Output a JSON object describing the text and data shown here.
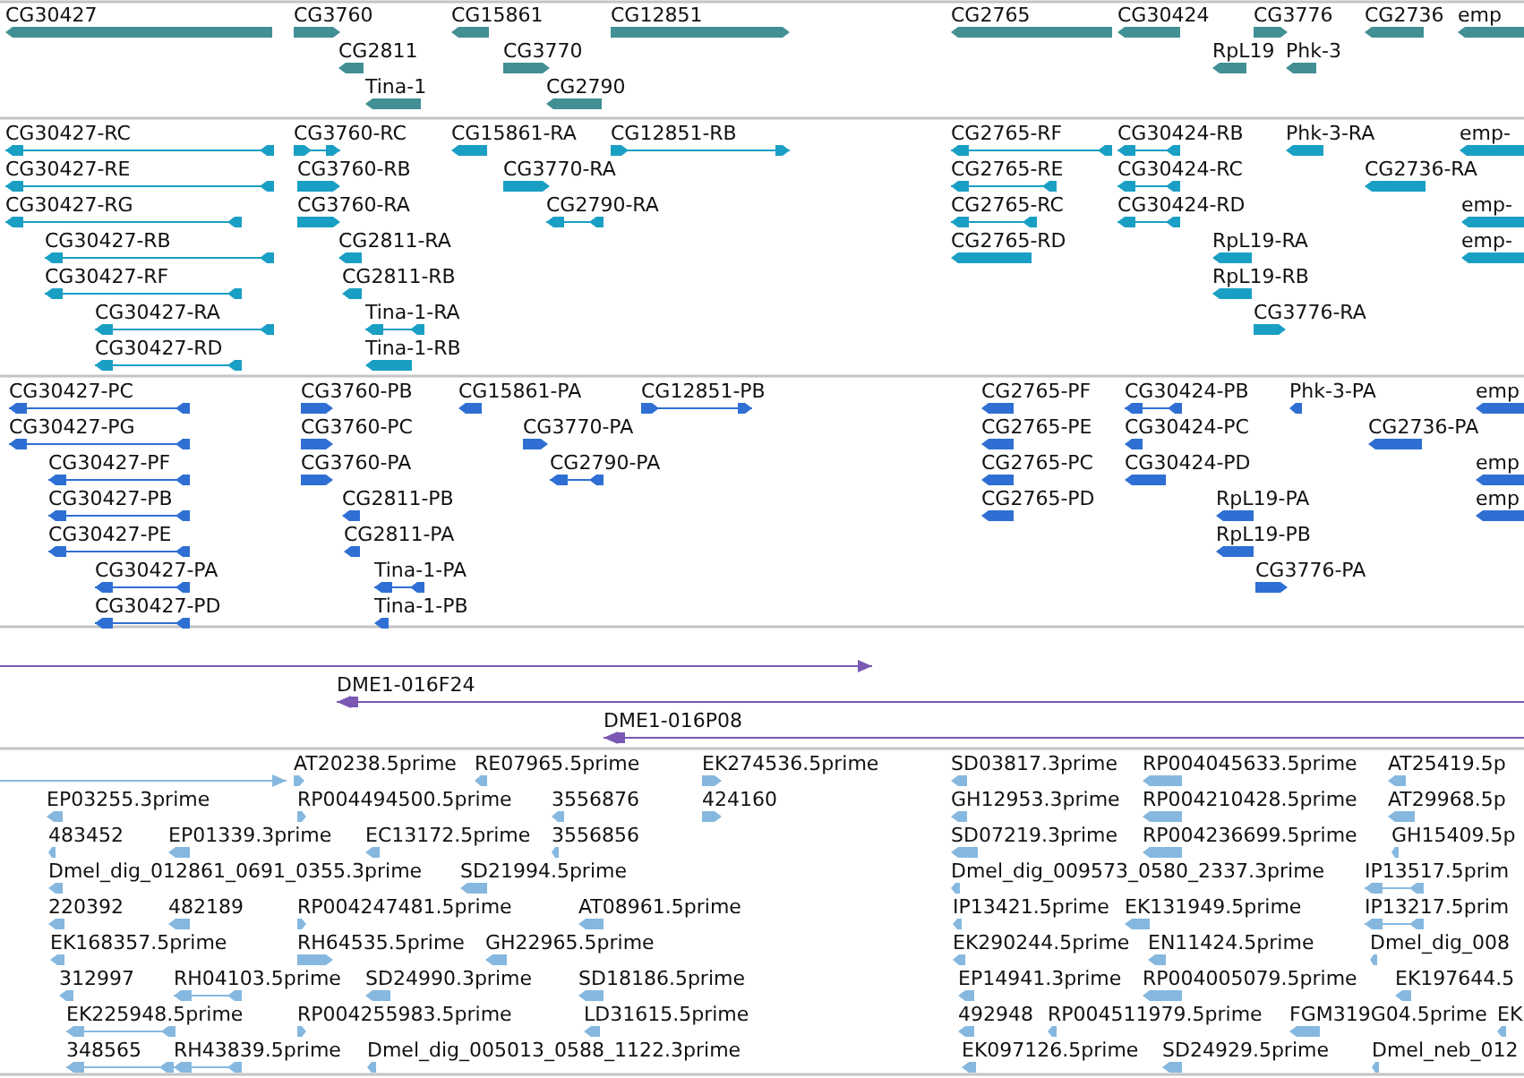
{
  "tracks": [
    {
      "kind": "gene",
      "features": [
        {
          "label": "CG30427",
          "kind": "reverse"
        },
        {
          "label": "CG3760",
          "kind": "forward"
        },
        {
          "label": "CG15861",
          "kind": "reverse"
        },
        {
          "label": "CG12851",
          "kind": "forward"
        },
        {
          "label": "CG2811",
          "kind": "reverse"
        },
        {
          "label": "CG3770",
          "kind": "forward"
        },
        {
          "label": "Tina-1",
          "kind": "reverse"
        },
        {
          "label": "CG2790",
          "kind": "reverse"
        },
        {
          "label": "CG2765",
          "kind": "reverse"
        },
        {
          "label": "CG30424",
          "kind": "reverse"
        },
        {
          "label": "CG3776",
          "kind": "forward"
        },
        {
          "label": "CG2736",
          "kind": "reverse"
        },
        {
          "label": "emp",
          "kind": "reverse"
        },
        {
          "label": "RpL19",
          "kind": "reverse"
        },
        {
          "label": "Phk-3",
          "kind": "reverse"
        }
      ]
    },
    {
      "kind": "transcript",
      "features": [
        {
          "label": "CG30427-RC",
          "kind": "reverse"
        },
        {
          "label": "CG30427-RE",
          "kind": "reverse"
        },
        {
          "label": "CG30427-RG",
          "kind": "reverse"
        },
        {
          "label": "CG30427-RB",
          "kind": "reverse"
        },
        {
          "label": "CG30427-RF",
          "kind": "reverse"
        },
        {
          "label": "CG30427-RA",
          "kind": "reverse"
        },
        {
          "label": "CG30427-RD",
          "kind": "reverse"
        },
        {
          "label": "CG3760-RC",
          "kind": "forward"
        },
        {
          "label": "CG3760-RB",
          "kind": "forward"
        },
        {
          "label": "CG3760-RA",
          "kind": "forward"
        },
        {
          "label": "CG2811-RA",
          "kind": "reverse"
        },
        {
          "label": "CG2811-RB",
          "kind": "reverse"
        },
        {
          "label": "Tina-1-RA",
          "kind": "reverse"
        },
        {
          "label": "Tina-1-RB",
          "kind": "reverse"
        },
        {
          "label": "CG15861-RA",
          "kind": "reverse"
        },
        {
          "label": "CG12851-RB",
          "kind": "forward"
        },
        {
          "label": "CG3770-RA",
          "kind": "forward"
        },
        {
          "label": "CG2790-RA",
          "kind": "reverse"
        },
        {
          "label": "CG2765-RF",
          "kind": "reverse"
        },
        {
          "label": "CG2765-RE",
          "kind": "reverse"
        },
        {
          "label": "CG2765-RC",
          "kind": "reverse"
        },
        {
          "label": "CG2765-RD",
          "kind": "reverse"
        },
        {
          "label": "CG30424-RB",
          "kind": "reverse"
        },
        {
          "label": "CG30424-RC",
          "kind": "reverse"
        },
        {
          "label": "CG30424-RD",
          "kind": "reverse"
        },
        {
          "label": "Phk-3-RA",
          "kind": "reverse"
        },
        {
          "label": "CG2736-RA",
          "kind": "reverse"
        },
        {
          "label": "RpL19-RA",
          "kind": "reverse"
        },
        {
          "label": "RpL19-RB",
          "kind": "reverse"
        },
        {
          "label": "CG3776-RA",
          "kind": "forward"
        },
        {
          "label": "emp-",
          "kind": "reverse"
        },
        {
          "label": "emp-",
          "kind": "reverse"
        },
        {
          "label": "emp-",
          "kind": "reverse"
        }
      ]
    },
    {
      "kind": "protein",
      "features": [
        {
          "label": "CG30427-PC",
          "kind": "reverse"
        },
        {
          "label": "CG30427-PG",
          "kind": "reverse"
        },
        {
          "label": "CG30427-PF",
          "kind": "reverse"
        },
        {
          "label": "CG30427-PB",
          "kind": "reverse"
        },
        {
          "label": "CG30427-PE",
          "kind": "reverse"
        },
        {
          "label": "CG30427-PA",
          "kind": "reverse"
        },
        {
          "label": "CG30427-PD",
          "kind": "reverse"
        },
        {
          "label": "CG3760-PB",
          "kind": "forward"
        },
        {
          "label": "CG3760-PC",
          "kind": "forward"
        },
        {
          "label": "CG3760-PA",
          "kind": "forward"
        },
        {
          "label": "CG2811-PB",
          "kind": "reverse"
        },
        {
          "label": "CG2811-PA",
          "kind": "reverse"
        },
        {
          "label": "Tina-1-PA",
          "kind": "reverse"
        },
        {
          "label": "Tina-1-PB",
          "kind": "reverse"
        },
        {
          "label": "CG15861-PA",
          "kind": "reverse"
        },
        {
          "label": "CG12851-PB",
          "kind": "forward"
        },
        {
          "label": "CG3770-PA",
          "kind": "forward"
        },
        {
          "label": "CG2790-PA",
          "kind": "reverse"
        },
        {
          "label": "CG2765-PF",
          "kind": "reverse"
        },
        {
          "label": "CG2765-PE",
          "kind": "reverse"
        },
        {
          "label": "CG2765-PC",
          "kind": "reverse"
        },
        {
          "label": "CG2765-PD",
          "kind": "reverse"
        },
        {
          "label": "CG30424-PB",
          "kind": "reverse"
        },
        {
          "label": "CG30424-PC",
          "kind": "reverse"
        },
        {
          "label": "CG30424-PD",
          "kind": "reverse"
        },
        {
          "label": "Phk-3-PA",
          "kind": "reverse"
        },
        {
          "label": "CG2736-PA",
          "kind": "reverse"
        },
        {
          "label": "RpL19-PA",
          "kind": "reverse"
        },
        {
          "label": "RpL19-PB",
          "kind": "reverse"
        },
        {
          "label": "CG3776-PA",
          "kind": "forward"
        },
        {
          "label": "emp",
          "kind": "reverse"
        },
        {
          "label": "emp",
          "kind": "reverse"
        },
        {
          "label": "emp",
          "kind": "reverse"
        }
      ]
    },
    {
      "kind": "clone",
      "features": [
        {
          "kind": "forward"
        },
        {
          "label": "DME1-016F24",
          "kind": "reverse"
        },
        {
          "label": "DME1-016P08",
          "kind": "reverse"
        }
      ]
    },
    {
      "kind": "est",
      "features": [
        {
          "kind": "forward"
        },
        {
          "label": "AT20238.5prime",
          "kind": "forward"
        },
        {
          "label": "RE07965.5prime",
          "kind": "reverse"
        },
        {
          "label": "EK274536.5prime",
          "kind": "forward"
        },
        {
          "label": "SD03817.3prime",
          "kind": "reverse"
        },
        {
          "label": "RP004045633.5prime",
          "kind": "reverse"
        },
        {
          "label": "AT25419.5p",
          "kind": "reverse"
        },
        {
          "label": "EP03255.3prime",
          "kind": "reverse"
        },
        {
          "label": "RP004494500.5prime",
          "kind": "forward"
        },
        {
          "label": "3556876",
          "kind": "reverse"
        },
        {
          "label": "424160",
          "kind": "forward"
        },
        {
          "label": "GH12953.3prime",
          "kind": "reverse"
        },
        {
          "label": "RP004210428.5prime",
          "kind": "reverse"
        },
        {
          "label": "AT29968.5p",
          "kind": "reverse"
        },
        {
          "label": "483452",
          "kind": "reverse"
        },
        {
          "label": "EP01339.3prime",
          "kind": "reverse"
        },
        {
          "label": "EC13172.5prime",
          "kind": "reverse"
        },
        {
          "label": "3556856",
          "kind": "reverse"
        },
        {
          "label": "SD07219.3prime",
          "kind": "reverse"
        },
        {
          "label": "RP004236699.5prime",
          "kind": "reverse"
        },
        {
          "label": "GH15409.5p",
          "kind": "reverse"
        },
        {
          "label": "Dmel_dig_012861_0691_0355.3prime",
          "kind": "reverse"
        },
        {
          "label": "SD21994.5prime",
          "kind": "reverse"
        },
        {
          "label": "Dmel_dig_009573_0580_2337.3prime",
          "kind": "reverse"
        },
        {
          "label": "IP13517.5prim",
          "kind": "reverse"
        },
        {
          "label": "220392",
          "kind": "reverse"
        },
        {
          "label": "482189",
          "kind": "reverse"
        },
        {
          "label": "RP004247481.5prime",
          "kind": "forward"
        },
        {
          "label": "AT08961.5prime",
          "kind": "reverse"
        },
        {
          "label": "IP13421.5prime",
          "kind": "reverse"
        },
        {
          "label": "EK131949.5prime",
          "kind": "reverse"
        },
        {
          "label": "IP13217.5prim",
          "kind": "reverse"
        },
        {
          "label": "EK168357.5prime",
          "kind": "reverse"
        },
        {
          "label": "RH64535.5prime",
          "kind": "forward"
        },
        {
          "label": "GH22965.5prime",
          "kind": "reverse"
        },
        {
          "label": "EK290244.5prime",
          "kind": "reverse"
        },
        {
          "label": "EN11424.5prime",
          "kind": "reverse"
        },
        {
          "label": "Dmel_dig_008",
          "kind": "reverse"
        },
        {
          "label": "312997",
          "kind": "reverse"
        },
        {
          "label": "RH04103.5prime",
          "kind": "reverse"
        },
        {
          "label": "SD24990.3prime",
          "kind": "reverse"
        },
        {
          "label": "SD18186.5prime",
          "kind": "reverse"
        },
        {
          "label": "EP14941.3prime",
          "kind": "reverse"
        },
        {
          "label": "RP004005079.5prime",
          "kind": "reverse"
        },
        {
          "label": "EK197644.5",
          "kind": "reverse"
        },
        {
          "label": "EK225948.5prime",
          "kind": "reverse"
        },
        {
          "label": "RP004255983.5prime",
          "kind": "forward"
        },
        {
          "label": "LD31615.5prime",
          "kind": "reverse"
        },
        {
          "label": "492948",
          "kind": "reverse"
        },
        {
          "label": "RP004511979.5prime",
          "kind": "reverse"
        },
        {
          "label": "FGM319G04.5prime",
          "kind": "reverse"
        },
        {
          "label": "EK",
          "kind": "reverse"
        },
        {
          "label": "348565",
          "kind": "reverse"
        },
        {
          "label": "RH43839.5prime",
          "kind": "reverse"
        },
        {
          "label": "Dmel_dig_005013_0588_1122.3prime",
          "kind": "reverse"
        },
        {
          "label": "EK097126.5prime",
          "kind": "reverse"
        },
        {
          "label": "SD24929.5prime",
          "kind": "reverse"
        },
        {
          "label": "Dmel_neb_012",
          "kind": "reverse"
        }
      ]
    }
  ]
}
